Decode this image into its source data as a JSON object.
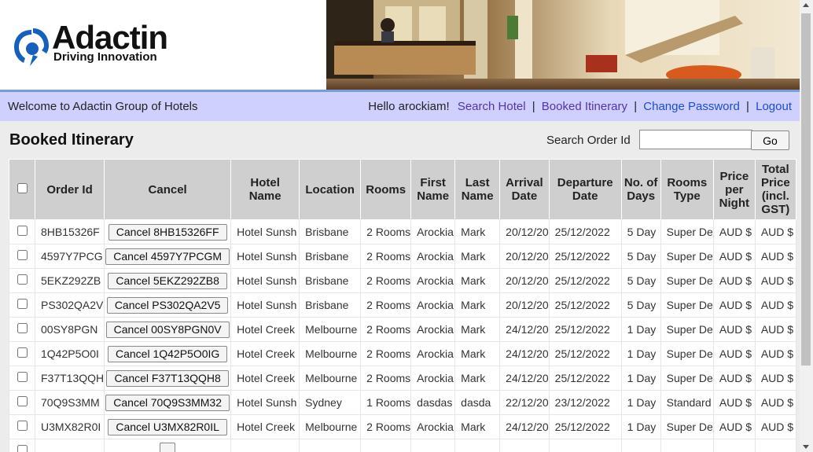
{
  "header": {
    "logo_text": "Adactin",
    "logo_tagline": "Driving Innovation"
  },
  "welcome_bar": {
    "welcome": "Welcome to Adactin Group of Hotels",
    "greeting": "Hello arockiam!",
    "links": {
      "search_hotel": "Search Hotel",
      "booked_itinerary": "Booked Itinerary",
      "change_password": "Change Password",
      "logout": "Logout"
    },
    "separator": "|"
  },
  "main": {
    "title": "Booked Itinerary",
    "search_label": "Search Order Id",
    "search_value": "",
    "go_label": "Go"
  },
  "table": {
    "headers": {
      "order_id": "Order Id",
      "cancel": "Cancel",
      "hotel_name": "Hotel Name",
      "location": "Location",
      "rooms": "Rooms",
      "first_name": "First Name",
      "last_name": "Last Name",
      "arrival_date": "Arrival Date",
      "departure_date": "Departure Date",
      "no_of_days": "No. of Days",
      "rooms_type": "Rooms Type",
      "price_per_night": "Price per Night",
      "total_price": "Total Price (incl. GST)"
    },
    "rows": [
      {
        "order_id": "8HB15326F",
        "cancel": "Cancel 8HB15326FF",
        "hotel": "Hotel Sunsh",
        "location": "Brisbane",
        "rooms": "2 Rooms",
        "first": "Arockia",
        "last": "Mark",
        "arrival": "20/12/20",
        "departure": "25/12/2022",
        "days": "5 Day",
        "type": "Super De",
        "price": "AUD $",
        "total": "AUD $"
      },
      {
        "order_id": "4597Y7PCG",
        "cancel": "Cancel 4597Y7PCGM",
        "hotel": "Hotel Sunsh",
        "location": "Brisbane",
        "rooms": "2 Rooms",
        "first": "Arockia",
        "last": "Mark",
        "arrival": "20/12/20",
        "departure": "25/12/2022",
        "days": "5 Day",
        "type": "Super De",
        "price": "AUD $",
        "total": "AUD $"
      },
      {
        "order_id": "5EKZ292ZB",
        "cancel": "Cancel 5EKZ292ZB8",
        "hotel": "Hotel Sunsh",
        "location": "Brisbane",
        "rooms": "2 Rooms",
        "first": "Arockia",
        "last": "Mark",
        "arrival": "20/12/20",
        "departure": "25/12/2022",
        "days": "5 Day",
        "type": "Super De",
        "price": "AUD $",
        "total": "AUD $"
      },
      {
        "order_id": "PS302QA2V",
        "cancel": "Cancel PS302QA2V5",
        "hotel": "Hotel Sunsh",
        "location": "Brisbane",
        "rooms": "2 Rooms",
        "first": "Arockia",
        "last": "Mark",
        "arrival": "20/12/20",
        "departure": "25/12/2022",
        "days": "5 Day",
        "type": "Super De",
        "price": "AUD $",
        "total": "AUD $"
      },
      {
        "order_id": "00SY8PGN",
        "cancel": "Cancel 00SY8PGN0V",
        "hotel": "Hotel Creek",
        "location": "Melbourne",
        "rooms": "2 Rooms",
        "first": "Arockia",
        "last": "Mark",
        "arrival": "24/12/20",
        "departure": "25/12/2022",
        "days": "1 Day",
        "type": "Super De",
        "price": "AUD $",
        "total": "AUD $"
      },
      {
        "order_id": "1Q42P5O0I",
        "cancel": "Cancel 1Q42P5O0IG",
        "hotel": "Hotel Creek",
        "location": "Melbourne",
        "rooms": "2 Rooms",
        "first": "Arockia",
        "last": "Mark",
        "arrival": "24/12/20",
        "departure": "25/12/2022",
        "days": "1 Day",
        "type": "Super De",
        "price": "AUD $",
        "total": "AUD $"
      },
      {
        "order_id": "F37T13QQH",
        "cancel": "Cancel F37T13QQH8",
        "hotel": "Hotel Creek",
        "location": "Melbourne",
        "rooms": "2 Rooms",
        "first": "Arockia",
        "last": "Mark",
        "arrival": "24/12/20",
        "departure": "25/12/2022",
        "days": "1 Day",
        "type": "Super De",
        "price": "AUD $",
        "total": "AUD $"
      },
      {
        "order_id": "70Q9S3MM",
        "cancel": "Cancel 70Q9S3MM32",
        "hotel": "Hotel Sunsh",
        "location": "Sydney",
        "rooms": "1 Rooms",
        "first": "dasdas",
        "last": "dasda",
        "arrival": "22/12/20",
        "departure": "23/12/2022",
        "days": "1 Day",
        "type": "Standard",
        "price": "AUD $",
        "total": "AUD $"
      },
      {
        "order_id": "U3MX82R0I",
        "cancel": "Cancel U3MX82R0IL",
        "hotel": "Hotel Creek",
        "location": "Melbourne",
        "rooms": "2 Rooms",
        "first": "Arockia",
        "last": "Mark",
        "arrival": "24/12/20",
        "departure": "25/12/2022",
        "days": "1 Day",
        "type": "Super De",
        "price": "AUD $",
        "total": "AUD $"
      },
      {
        "order_id": "",
        "cancel": "",
        "hotel": "",
        "location": "",
        "rooms": "",
        "first": "",
        "last": "",
        "arrival": "",
        "departure": "",
        "days": "",
        "type": "",
        "price": "",
        "total": ""
      }
    ]
  },
  "colors": {
    "welcome_bar_bg": "#d0d0ff",
    "link_purple": "#5533aa",
    "link_blue": "#1a4fcf",
    "header_cell_bg": "#cfcfcf",
    "page_bg": "#ececec",
    "logo_blue": "#1560bd"
  },
  "icons": [
    "adactin-logo-icon",
    "hotel-lobby-image",
    "scroll-up-icon",
    "scroll-down-icon"
  ]
}
